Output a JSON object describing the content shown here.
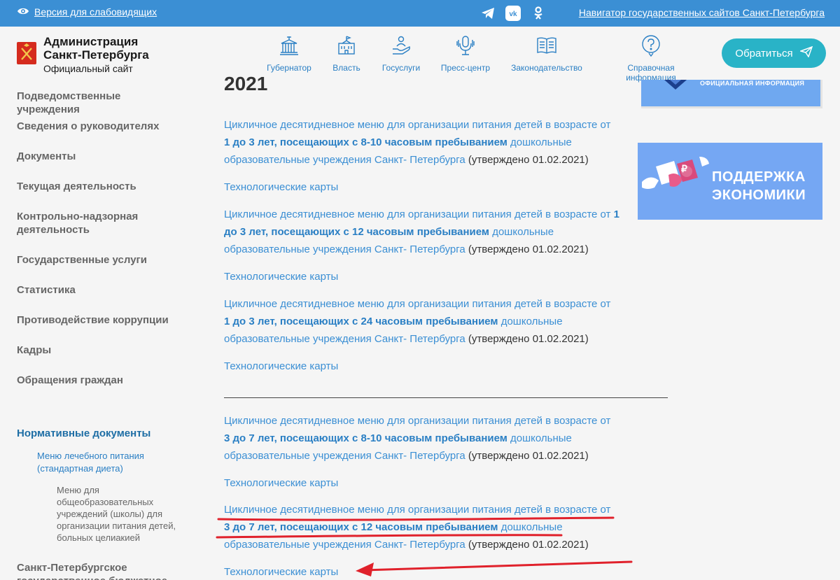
{
  "topbar": {
    "accessibility_label": "Версия для слабовидящих",
    "navigator_link": "Навигатор государственных сайтов Санкт-Петербурга",
    "socials": [
      "telegram-icon",
      "vk-icon",
      "odnoklassniki-icon"
    ]
  },
  "header": {
    "brand_line1": "Администрация",
    "brand_line2": "Санкт-Петербурга",
    "brand_line3": "Официальный сайт",
    "nav": [
      {
        "label": "Губернатор",
        "icon": "governor-building-icon"
      },
      {
        "label": "Власть",
        "icon": "government-building-icon"
      },
      {
        "label": "Госуслуги",
        "icon": "hand-person-icon"
      },
      {
        "label": "Пресс-центр",
        "icon": "microphone-icon"
      },
      {
        "label": "Законодательство",
        "icon": "book-icon"
      },
      {
        "label": "Справочная информация",
        "icon": "question-bubble-icon"
      }
    ],
    "cta_label": "Обратиться"
  },
  "sidebar": {
    "items": [
      "Подведомственные учреждения",
      "Сведения о руководителях",
      "Документы",
      "Текущая деятельность",
      "Контрольно-надзорная деятельность",
      "Государственные услуги",
      "Статистика",
      "Противодействие коррупции",
      "Кадры",
      "Обращения граждан"
    ],
    "section": "Нормативные документы",
    "sub": "Меню лечебного питания (стандартная диета)",
    "subsub": "Меню для общеобразовательных учреждений (школы) для организации питания детей, больных целиакией",
    "bottom": "Санкт-Петербургское государственное бюджетное"
  },
  "content": {
    "year": "2021",
    "menu_prefix": "Цикличное десятидневное меню для организации питания детей в возрасте от",
    "menu_suffix": "дошкольные образовательные учреждения Санкт- Петербурга",
    "approved": "(утверждено 01.02.2021)",
    "tech_cards": "Технологические карты",
    "items": [
      {
        "bold": "1 до 3 лет, посещающих с 8-10 часовым пребыванием"
      },
      {
        "bold": "1 до 3 лет, посещающих с 12 часовым пребыванием"
      },
      {
        "bold": "1 до 3 лет, посещающих с 24 часовым пребыванием"
      },
      {
        "bold": "3 до 7 лет, посещающих с 8-10 часовым пребыванием"
      },
      {
        "bold": "3 до 7 лет, посещающих с 12 часовым пребыванием"
      }
    ]
  },
  "banners": {
    "top_label": "ОФИЦИАЛЬНАЯ ИНФОРМАЦИЯ",
    "economy_line1": "ПОДДЕРЖКА",
    "economy_line2": "ЭКОНОМИКИ",
    "ruble_symbol": "₽"
  },
  "colors": {
    "topbar": "#3b8fd4",
    "link": "#3b8fd4",
    "cta": "#29b3c7",
    "annotation": "#e0212b"
  }
}
